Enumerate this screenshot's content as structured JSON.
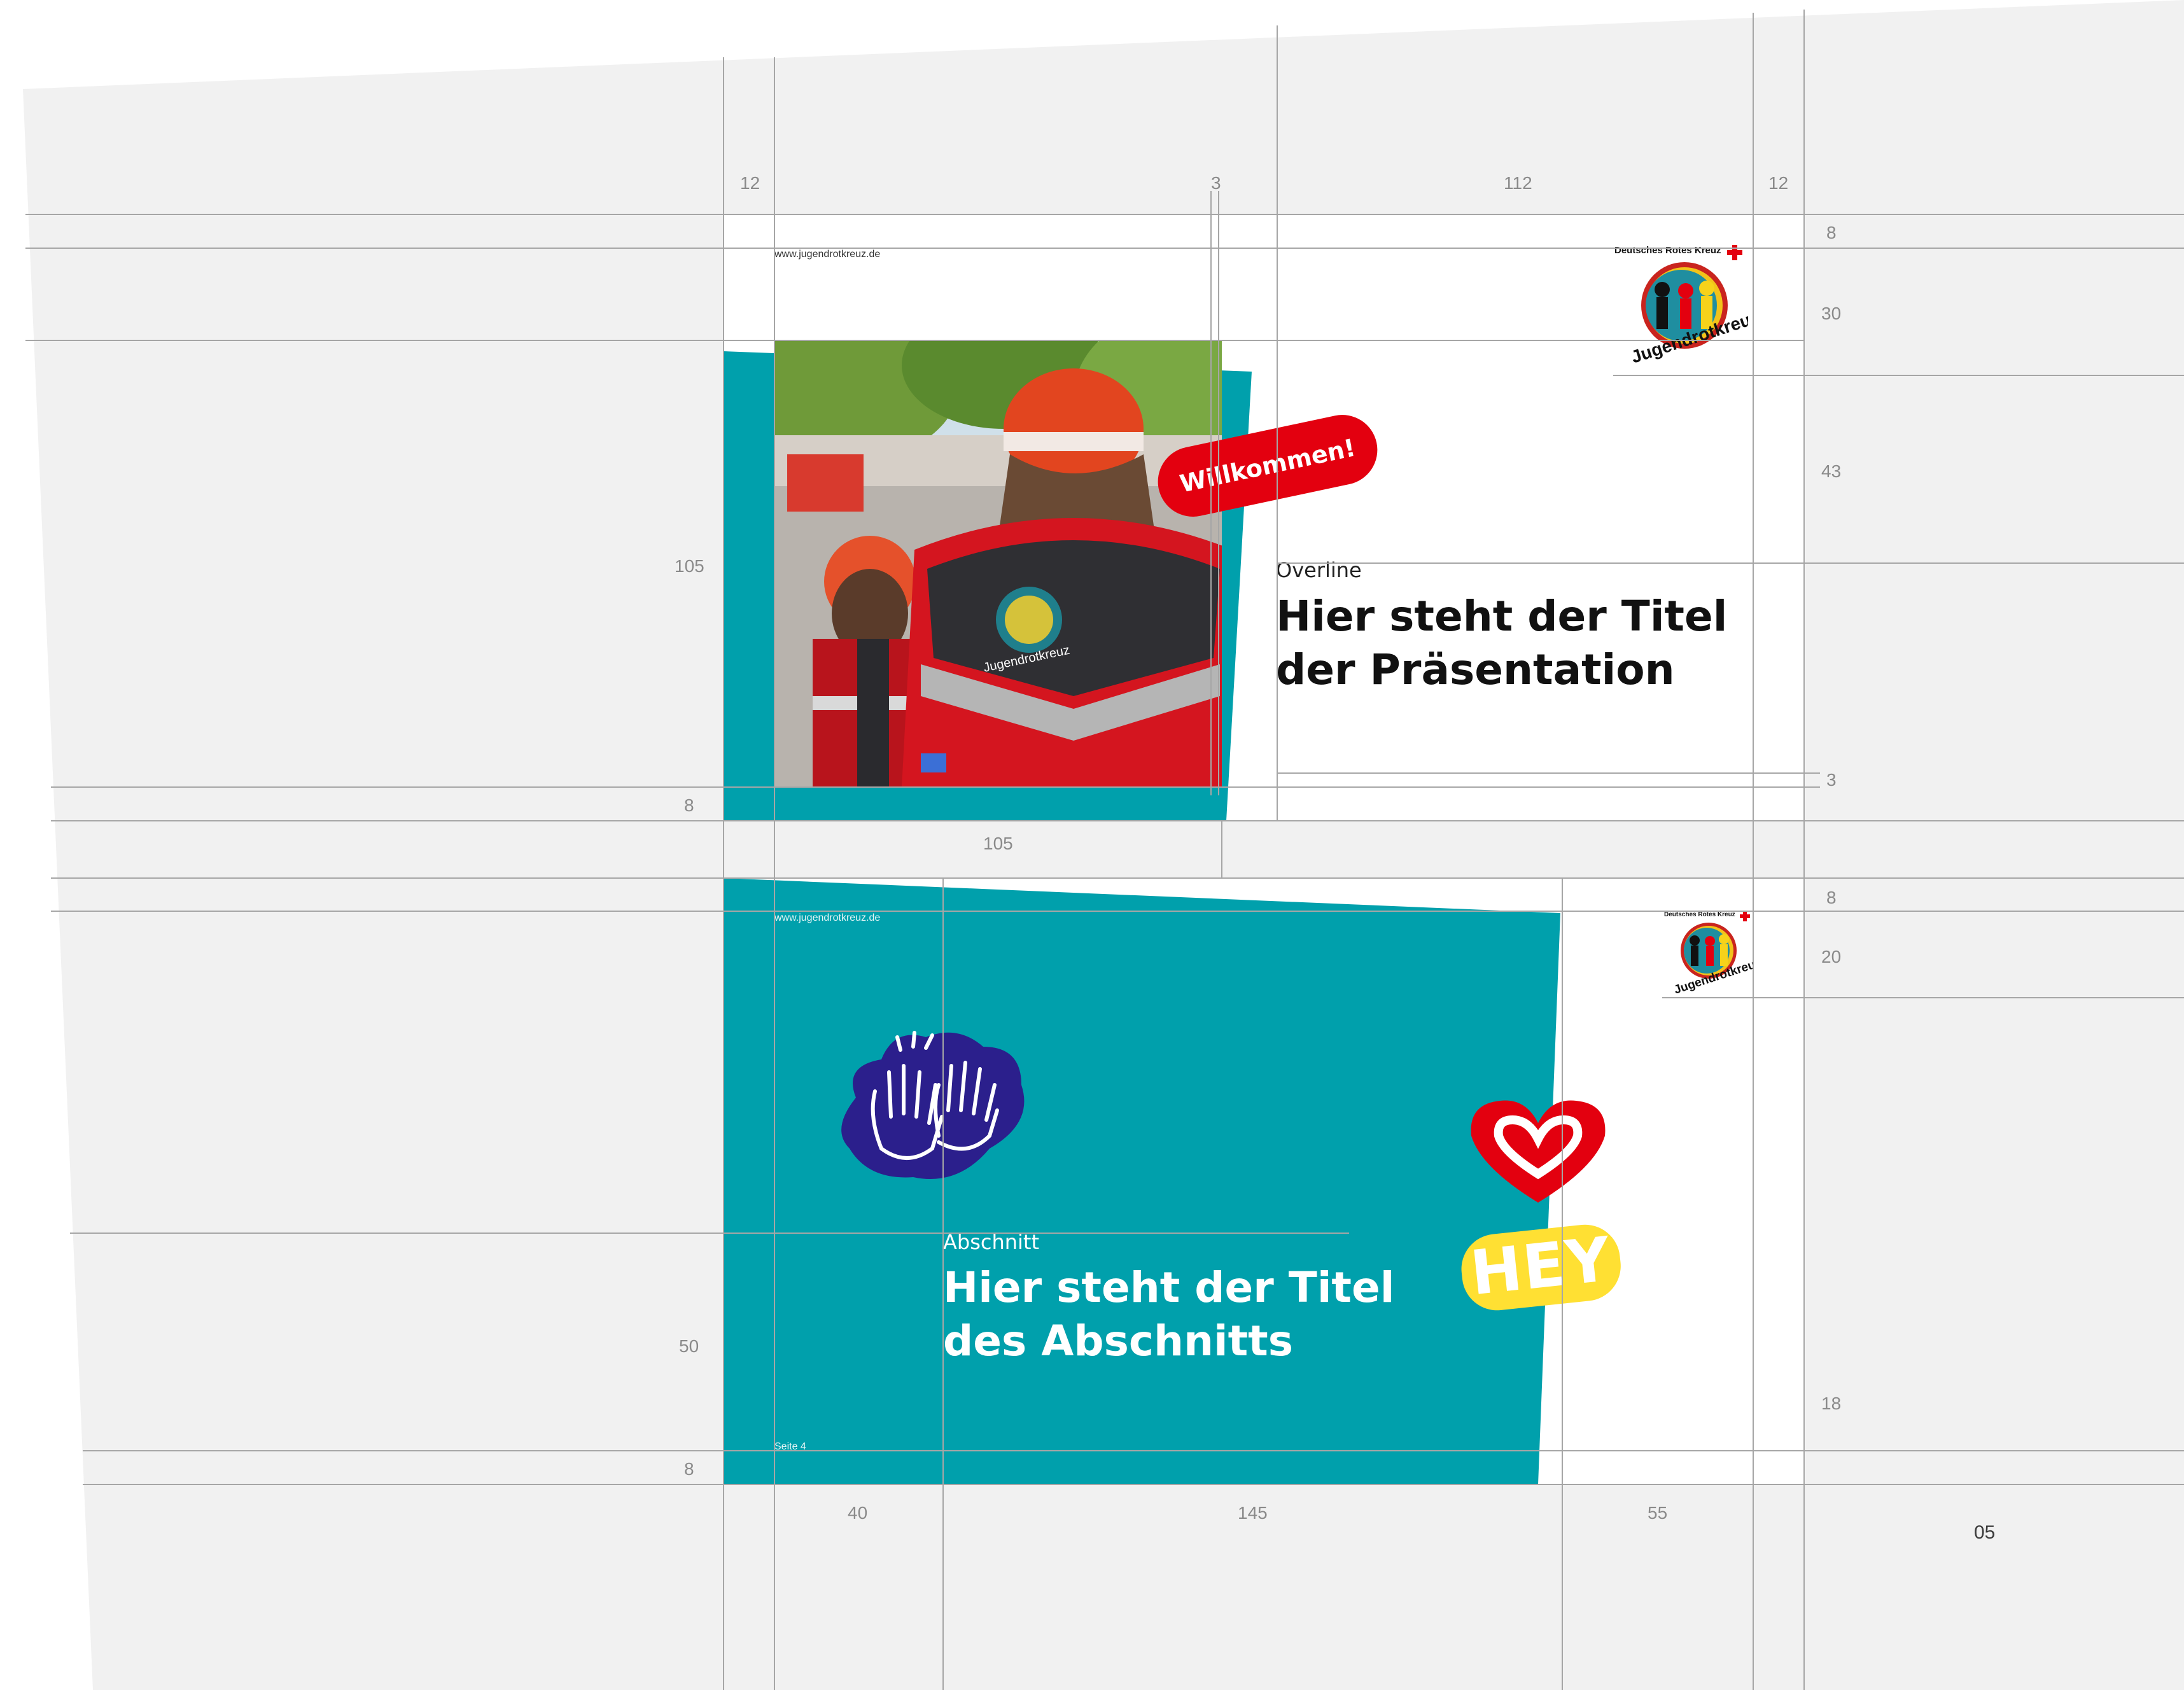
{
  "colors": {
    "teal": "#00a0ac",
    "red": "#e3000f",
    "navy": "#2b1f8c",
    "yellow": "#ffe033",
    "sheet": "#f1f1f1",
    "guide": "#a6a6a6"
  },
  "slide1": {
    "url": "www.jugendrotkreuz.de",
    "overline": "Overline",
    "title_line1": "Hier steht der Titel",
    "title_line2": "der Präsentation",
    "sticker": "Willkommen!",
    "photo": "photo-helmet-jacket-icon"
  },
  "slide2": {
    "url": "www.jugendrotkreuz.de",
    "overline": "Abschnitt",
    "title_line1": "Hier steht der Titel",
    "title_line2": "des Abschnitts",
    "footer": "Seite 4",
    "hey": "HEY",
    "clapping": "clapping-hands-icon",
    "heart": "heart-sticker-icon"
  },
  "logo": {
    "org": "Deutsches Rotes Kreuz",
    "name": "Jugendrotkreuz"
  },
  "measurements": {
    "top_row": [
      "12",
      "3",
      "112",
      "12"
    ],
    "right_slide1": [
      "8",
      "30",
      "43",
      "3"
    ],
    "left_slide1": [
      "105",
      "8"
    ],
    "below_slide1": "105",
    "right_slide2": [
      "8",
      "20",
      "18"
    ],
    "left_slide2": [
      "50",
      "8"
    ],
    "bottom_row": [
      "40",
      "145",
      "55"
    ]
  },
  "page_number": "05"
}
